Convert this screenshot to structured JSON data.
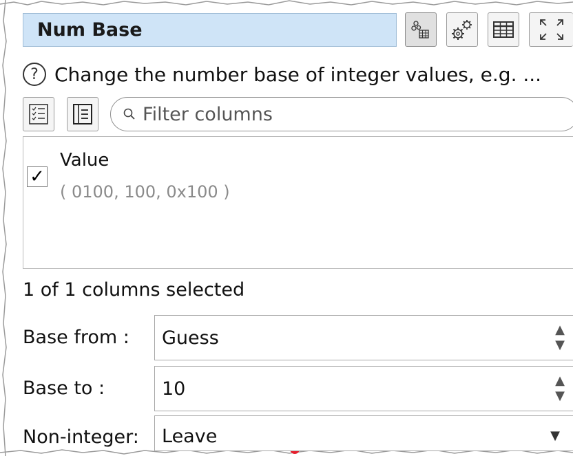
{
  "header": {
    "title": "Num Base",
    "buttons": [
      {
        "name": "node-data-icon",
        "pressed": true
      },
      {
        "name": "settings-gears-icon",
        "pressed": false
      },
      {
        "name": "table-view-icon",
        "pressed": false
      },
      {
        "name": "maximize-icon",
        "pressed": false
      }
    ]
  },
  "description": {
    "help_glyph": "?",
    "text": "Change the number base of integer values, e.g. ..."
  },
  "filter": {
    "placeholder": "Filter columns",
    "value": ""
  },
  "columns": [
    {
      "name": "Value",
      "sample": "( 0100, 100, 0x100 )",
      "checked": true
    }
  ],
  "selection_status": "1 of 1 columns selected",
  "form": {
    "base_from": {
      "label": "Base from :",
      "value": "Guess"
    },
    "base_to": {
      "label": "Base to :",
      "value": "10"
    },
    "non_integer": {
      "label": "Non-integer:",
      "value": "Leave"
    }
  },
  "colors": {
    "title_bg": "#cfe4f7",
    "title_border": "#9fbcd6",
    "drag_dot": "#e5202e"
  }
}
